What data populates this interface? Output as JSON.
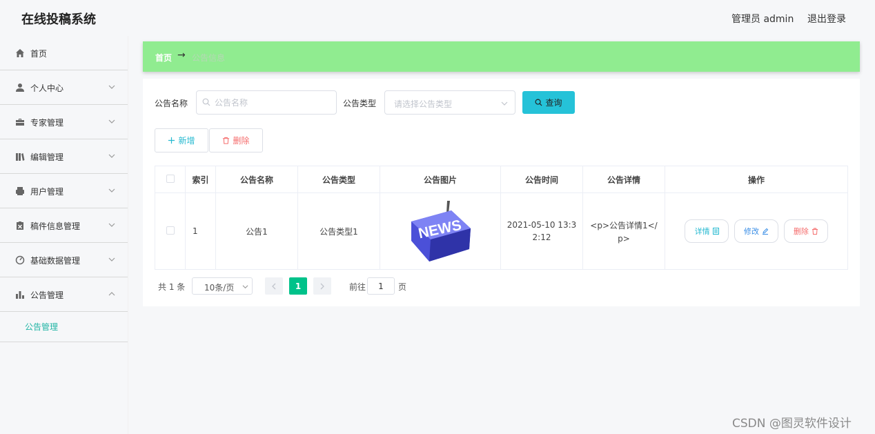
{
  "header": {
    "title": "在线投稿系统",
    "user_label": "管理员 admin",
    "logout_label": "退出登录"
  },
  "sidebar": {
    "items": [
      {
        "label": "首页",
        "icon": "home-icon"
      },
      {
        "label": "个人中心",
        "icon": "user-icon"
      },
      {
        "label": "专家管理",
        "icon": "briefcase-icon"
      },
      {
        "label": "编辑管理",
        "icon": "books-icon"
      },
      {
        "label": "用户管理",
        "icon": "printer-icon"
      },
      {
        "label": "稿件信息管理",
        "icon": "clipboard-icon"
      },
      {
        "label": "基础数据管理",
        "icon": "gauge-icon"
      },
      {
        "label": "公告管理",
        "icon": "bar-chart-icon"
      }
    ],
    "sub_item": "公告管理"
  },
  "breadcrumb": {
    "home": "首页",
    "arrow": "→",
    "current": "公告信息"
  },
  "search": {
    "name_label": "公告名称",
    "name_placeholder": "公告名称",
    "type_label": "公告类型",
    "type_placeholder": "请选择公告类型",
    "query_button": "查询"
  },
  "actions": {
    "add": "新增",
    "delete": "删除"
  },
  "table": {
    "headers": [
      "索引",
      "公告名称",
      "公告类型",
      "公告图片",
      "公告时间",
      "公告详情",
      "操作"
    ],
    "rows": [
      {
        "index": "1",
        "name": "公告1",
        "type": "公告类型1",
        "image_text": "NEWS",
        "time_line1": "2021-05-10 13:3",
        "time_line2": "2:12",
        "detail_line1": "<p>公告详情1</",
        "detail_line2": "p>",
        "btn_detail": "详情",
        "btn_edit": "修改",
        "btn_delete": "删除"
      }
    ]
  },
  "pagination": {
    "total": "共 1 条",
    "page_size": "10条/页",
    "current_page": "1",
    "goto_label": "前往",
    "goto_value": "1",
    "page_unit": "页"
  },
  "watermark": "CSDN @图灵软件设计",
  "colors": {
    "accent": "#22b5a5",
    "breadcrumb_bg": "#90ec90",
    "query_btn": "#25c2d8",
    "danger": "#f56c6c",
    "page_active": "#00c28a"
  }
}
